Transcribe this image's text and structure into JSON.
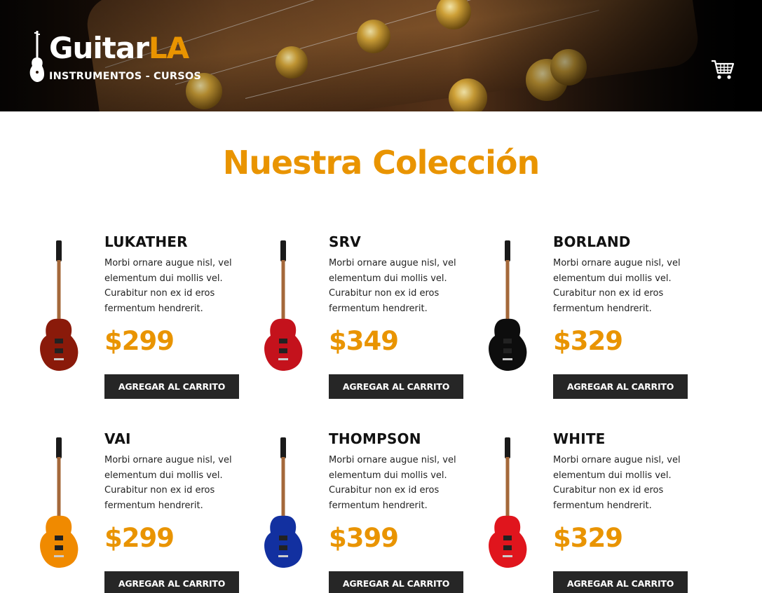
{
  "header": {
    "brand_main": "Guitar",
    "brand_accent": "LA",
    "tagline": "INSTRUMENTOS - CURSOS",
    "cart_icon": "shopping-cart-icon"
  },
  "collection": {
    "title": "Nuestra Colección",
    "button_label": "AGREGAR AL CARRITO",
    "products": [
      {
        "name": "LUKATHER",
        "description": "Morbi ornare augue nisl, vel elementum dui mollis vel. Curabitur non ex id eros fermentum hendrerit.",
        "price": "$299",
        "color": "#8a1a0a"
      },
      {
        "name": "SRV",
        "description": "Morbi ornare augue nisl, vel elementum dui mollis vel. Curabitur non ex id eros fermentum hendrerit.",
        "price": "$349",
        "color": "#c4121c"
      },
      {
        "name": "BORLAND",
        "description": "Morbi ornare augue nisl, vel elementum dui mollis vel. Curabitur non ex id eros fermentum hendrerit.",
        "price": "$329",
        "color": "#0d0d0d"
      },
      {
        "name": "VAI",
        "description": "Morbi ornare augue nisl, vel elementum dui mollis vel. Curabitur non ex id eros fermentum hendrerit.",
        "price": "$299",
        "color": "#f08a00"
      },
      {
        "name": "THOMPSON",
        "description": "Morbi ornare augue nisl, vel elementum dui mollis vel. Curabitur non ex id eros fermentum hendrerit.",
        "price": "$399",
        "color": "#1230a0"
      },
      {
        "name": "WHITE",
        "description": "Morbi ornare augue nisl, vel elementum dui mollis vel. Curabitur non ex id eros fermentum hendrerit.",
        "price": "$329",
        "color": "#e0151d"
      }
    ]
  },
  "colors": {
    "accent": "#e99400",
    "button_bg": "#262626"
  }
}
